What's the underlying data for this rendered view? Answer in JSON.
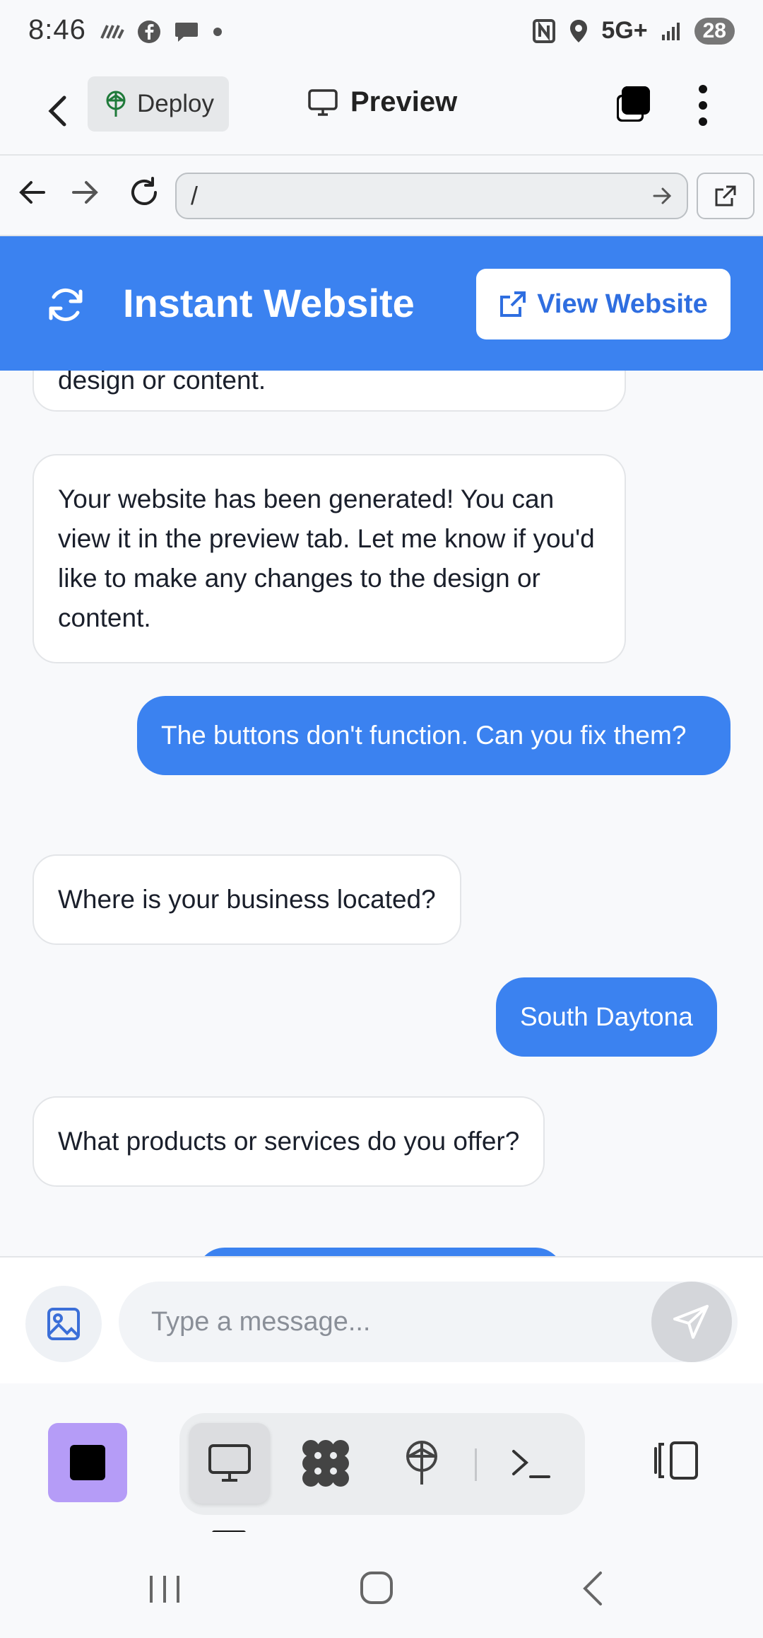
{
  "status_bar": {
    "time": "8:46",
    "network": "5G+",
    "battery": "28"
  },
  "app_bar": {
    "deploy_label": "Deploy",
    "preview_label": "Preview"
  },
  "browser": {
    "url": "/"
  },
  "site_header": {
    "title": "Instant Website",
    "view_button_label": "View Website",
    "color": "#3b82f0"
  },
  "chat": {
    "messages": [
      {
        "role": "bot",
        "text": "design or content."
      },
      {
        "role": "bot",
        "text": "Your website has been generated! You can view it in the preview tab. Let me know if you'd like to make any changes to the design or content."
      },
      {
        "role": "user",
        "text": "The buttons don't function.  Can you fix them?"
      },
      {
        "role": "bot",
        "text": "Where is your business located?"
      },
      {
        "role": "user",
        "text": "South Daytona"
      },
      {
        "role": "bot",
        "text": "What products or services do you offer?"
      }
    ]
  },
  "composer": {
    "placeholder": "Type a message..."
  },
  "toolbar": {
    "accent": "#b59cf7",
    "tools": [
      "monitor-icon",
      "grid-icon",
      "deploy-icon",
      "terminal-icon"
    ]
  }
}
